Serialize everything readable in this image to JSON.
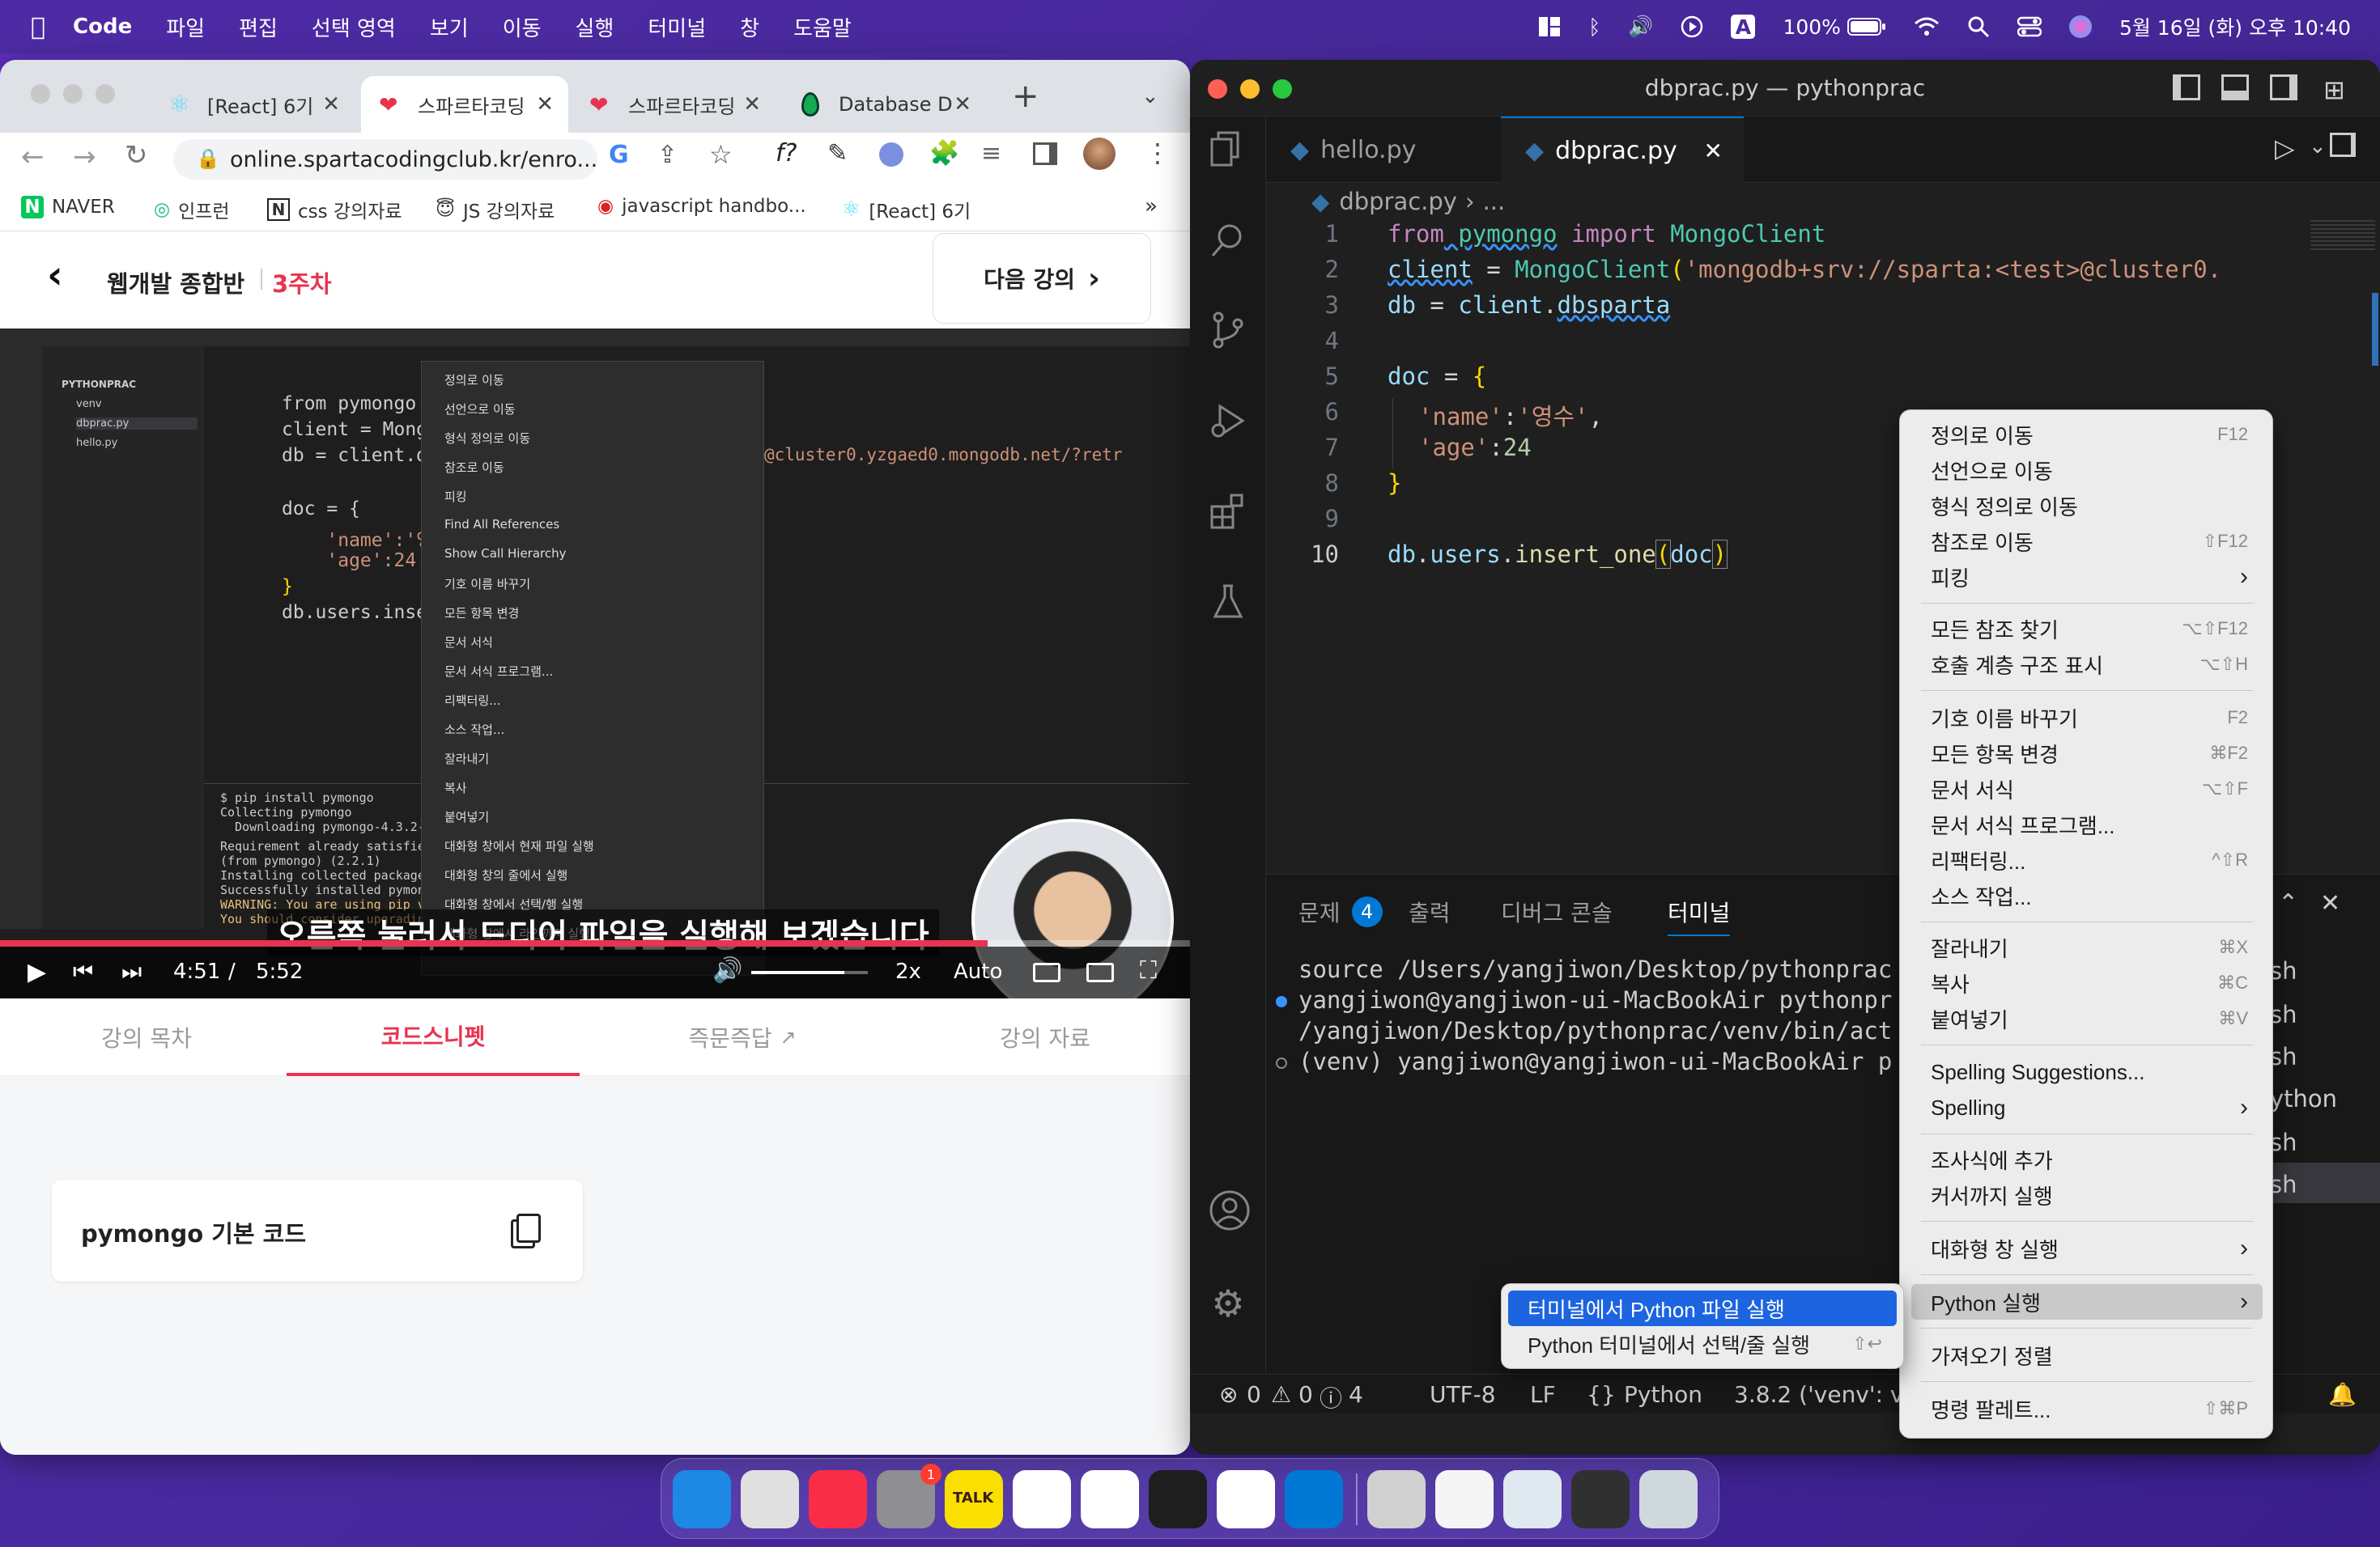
{
  "menubar": {
    "app": "Code",
    "items": [
      "파일",
      "편집",
      "선택 영역",
      "보기",
      "이동",
      "실행",
      "터미널",
      "창",
      "도움말"
    ],
    "battery": "100%",
    "datetime": "5월 16일 (화) 오후 10:40",
    "input_indicator": "A"
  },
  "chrome": {
    "tabs": [
      {
        "title": "[React] 6기"
      },
      {
        "title": "스파르타코딩"
      },
      {
        "title": "스파르타코딩"
      },
      {
        "title": "Database D"
      }
    ],
    "new_tab": "+",
    "url": "online.spartacodingclub.kr/enro...",
    "bookmarks": [
      "NAVER",
      "인프런",
      "css 강의자료",
      "JS 강의자료",
      "javascript handbo...",
      "[React] 6기"
    ],
    "more_bookmarks": "»"
  },
  "course": {
    "title": "웹개발 종합반",
    "week": "3주차",
    "next_label": "다음 강의",
    "video": {
      "subtitle": "오른쪽 눌러서 드디어 파일을 실행해 보겠습니다",
      "current_time": "4:51",
      "separator": "/",
      "duration": "5:52",
      "speed": "2x",
      "quality": "Auto",
      "progress": 0.83,
      "volume": 0.8,
      "inner_code": [
        "from pymongo i",
        "client = Mongo",
        "db = client.db",
        "",
        "doc = {",
        "    'name':'영",
        "    'age':24",
        "}",
        "db.users.inser"
      ],
      "inner_url": "@cluster0.yzgaed0.mongodb.net/?retr",
      "inner_menu": [
        "정의로 이동",
        "선언으로 이동",
        "형식 정의로 이동",
        "참조로 이동",
        "피킹",
        "Find All References",
        "Show Call Hierarchy",
        "기호 이름 바꾸기",
        "모든 항목 변경",
        "문서 서식",
        "문서 서식 프로그램...",
        "리팩터링...",
        "소스 작업...",
        "잘라내기",
        "복사",
        "붙여넣기",
        "대화형 창에서 현재 파일 실행",
        "대화형 창의 줄에서 실행",
        "대화형 창에서 선택/행 실행",
        "대화형 창에서 라인까지 실행"
      ],
      "inner_terminal": [
        "$ pip install pymongo",
        "Collecting pymongo",
        "  Downloading pymongo-4.3.2-c",
        "Requirement already satisfied",
        "(from pymongo) (2.2.1)",
        "Installing collected packages",
        "Successfully installed pymong",
        "WARNING: You are using pip ve",
        "You should consider upgrading"
      ],
      "inner_folder": "PYTHONPRAC",
      "inner_files": [
        "venv",
        "dbprac.py",
        "hello.py"
      ]
    },
    "tabs": [
      "강의 목차",
      "코드스니펫",
      "즉문즉답",
      "강의 자료"
    ],
    "active_tab": "코드스니펫",
    "snippet_title": "pymongo 기본 코드"
  },
  "vscode": {
    "window_title": "dbprac.py — pythonprac",
    "tabs": [
      {
        "name": "hello.py"
      },
      {
        "name": "dbprac.py"
      }
    ],
    "breadcrumb": "dbprac.py",
    "breadcrumb_more": "...",
    "code_lines": [
      "1",
      "2",
      "3",
      "4",
      "5",
      "6",
      "7",
      "8",
      "9",
      "10"
    ],
    "code": {
      "l1": [
        "from",
        " pymongo",
        " import",
        " MongoClient"
      ],
      "l2": [
        "client",
        " = ",
        "MongoClient",
        "(",
        "'mongodb+srv://sparta:<test>@cluster0."
      ],
      "l3": [
        "db",
        " = ",
        "client",
        ".",
        "dbsparta"
      ],
      "l5": [
        "doc",
        " = ",
        "{"
      ],
      "l6": [
        "'name'",
        ":",
        "'영수'",
        ","
      ],
      "l7": [
        "'age'",
        ":",
        "24"
      ],
      "l8": [
        "}"
      ],
      "l10": [
        "db",
        ".",
        "users",
        ".",
        "insert_one",
        "(",
        "doc",
        ")"
      ]
    },
    "panel_tabs": [
      "문제",
      "출력",
      "디버그 콘솔",
      "터미널"
    ],
    "problem_count": "4",
    "terminal_lines": [
      "source /Users/yangjiwon/Desktop/pythonprac",
      "yangjiwon@yangjiwon-ui-MacBookAir pythonpr",
      "/yangjiwon/Desktop/pythonprac/venv/bin/act",
      "(venv) yangjiwon@yangjiwon-ui-MacBookAir p"
    ],
    "terminal_side": [
      "sh",
      "sh",
      "sh",
      "ython",
      "sh",
      "sh"
    ],
    "status": {
      "errors": "0",
      "warnings": "0",
      "infos": "4",
      "encoding": "UTF-8",
      "eol": "LF",
      "language": "Python",
      "interpreter": "3.8.2 ('venv': v"
    }
  },
  "context_menu": {
    "items": [
      {
        "label": "정의로 이동",
        "shortcut": "F12"
      },
      {
        "label": "선언으로 이동",
        "shortcut": ""
      },
      {
        "label": "형식 정의로 이동",
        "shortcut": ""
      },
      {
        "label": "참조로 이동",
        "shortcut": "⇧F12"
      },
      {
        "label": "피킹",
        "shortcut": "›"
      },
      {
        "label": "모든 참조 찾기",
        "shortcut": "⌥⇧F12"
      },
      {
        "label": "호출 계층 구조 표시",
        "shortcut": "⌥⇧H"
      },
      {
        "label": "기호 이름 바꾸기",
        "shortcut": "F2"
      },
      {
        "label": "모든 항목 변경",
        "shortcut": "⌘F2"
      },
      {
        "label": "문서 서식",
        "shortcut": "⌥⇧F"
      },
      {
        "label": "문서 서식 프로그램...",
        "shortcut": ""
      },
      {
        "label": "리팩터링...",
        "shortcut": "^⇧R"
      },
      {
        "label": "소스 작업...",
        "shortcut": ""
      },
      {
        "label": "잘라내기",
        "shortcut": "⌘X"
      },
      {
        "label": "복사",
        "shortcut": "⌘C"
      },
      {
        "label": "붙여넣기",
        "shortcut": "⌘V"
      },
      {
        "label": "Spelling Suggestions...",
        "shortcut": ""
      },
      {
        "label": "Spelling",
        "shortcut": "›"
      },
      {
        "label": "조사식에 추가",
        "shortcut": ""
      },
      {
        "label": "커서까지 실행",
        "shortcut": ""
      },
      {
        "label": "대화형 창 실행",
        "shortcut": "›"
      },
      {
        "label": "Python 실행",
        "shortcut": "›"
      },
      {
        "label": "가져오기 정렬",
        "shortcut": ""
      },
      {
        "label": "명령 팔레트...",
        "shortcut": "⇧⌘P"
      }
    ]
  },
  "submenu": {
    "items": [
      {
        "label": "터미널에서 Python 파일 실행",
        "shortcut": ""
      },
      {
        "label": "Python 터미널에서 선택/줄 실행",
        "shortcut": "⇧↩"
      }
    ]
  },
  "dock": {
    "apps": [
      "finder-icon",
      "launchpad-icon",
      "music-icon",
      "system-settings-icon",
      "kakaotalk-icon",
      "slack-icon",
      "chrome-icon",
      "terminal-icon",
      "notion-icon",
      "vscode-icon",
      "preview-icon",
      "doc-icon",
      "window-icon",
      "chrome-window-icon",
      "trash-icon"
    ],
    "talk_label": "TALK",
    "settings_badge": "1",
    "colors": [
      "#1e88e5",
      "#e0e0e0",
      "#fa2d48",
      "#8e8e93",
      "#f9e000",
      "#ffffff",
      "#ffffff",
      "#1e1e1e",
      "#ffffff",
      "#0078d4",
      "#d0d0d0",
      "#f5f5f5",
      "#e0e8f0",
      "#303030",
      "#cfd8dc"
    ]
  }
}
